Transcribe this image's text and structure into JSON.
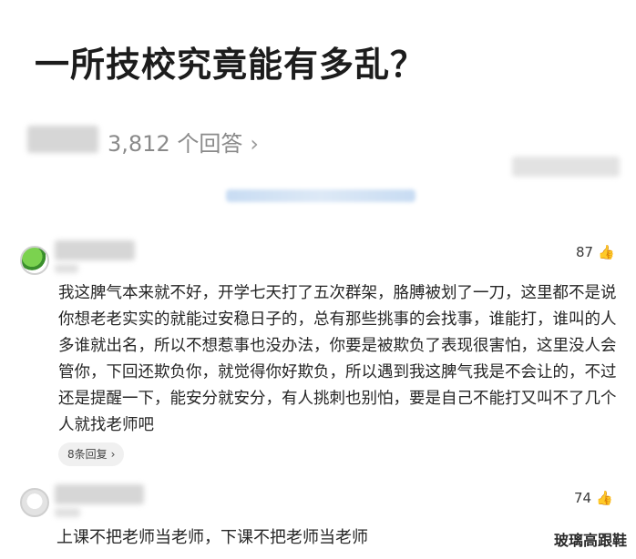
{
  "question": {
    "title": "一所技校究竟能有多乱？",
    "answer_count": "3,812 个回答",
    "chevron": "›"
  },
  "answers": [
    {
      "likes": "87",
      "like_icon": "thumb-up-icon",
      "text": "我这脾气本来就不好，开学七天打了五次群架，胳膊被划了一刀，这里都不是说你想老老实实的就能过安稳日子的，总有那些挑事的会找事，谁能打，谁叫的人多谁就出名，所以不想惹事也没办法，你要是被欺负了表现很害怕，这里没人会管你，下回还欺负你，就觉得你好欺负，所以遇到我这脾气我是不会让的，不过还是提醒一下，能安分就安分，有人挑刺也别怕，要是自己不能打又叫不了几个人就找老师吧",
      "replies": "8条回复",
      "replies_chevron": "›"
    },
    {
      "likes": "74",
      "like_icon": "thumb-up-icon",
      "text": "上课不把老师当老师，下课不把老师当老师"
    }
  ],
  "watermark": "玻璃高跟鞋",
  "thumb_glyph": "👍"
}
